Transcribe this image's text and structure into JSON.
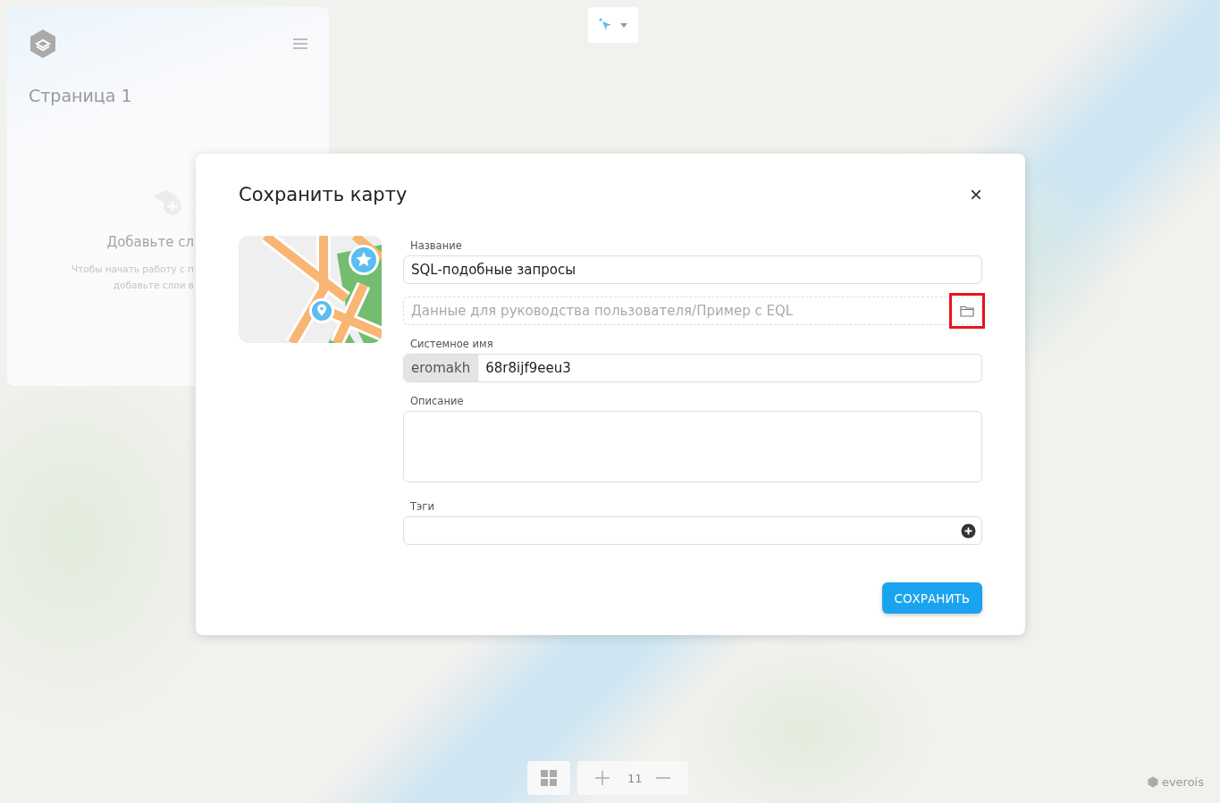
{
  "sidebar": {
    "page_title": "Страница 1",
    "empty_title": "Добавьте сл",
    "empty_hint_lines": [
      "Чтобы начать работу с п",
      "добавьте слои в"
    ]
  },
  "dialog": {
    "title": "Сохранить карту",
    "close": "×",
    "fields": [
      {
        "kind": "text",
        "label": "Название",
        "value": "SQL-подобные запросы"
      },
      {
        "kind": "folder",
        "placeholder": "Данные для руководства пользователя/Пример с EQL",
        "highlighted": true
      },
      {
        "kind": "prefixed",
        "label": "Системное имя",
        "prefix": "eromakh",
        "value": "68r8ijf9eeu3"
      },
      {
        "kind": "textarea",
        "label": "Описание"
      },
      {
        "kind": "tags",
        "label": "Тэги"
      }
    ],
    "save_button": "СОХРАНИТЬ"
  },
  "map_controls": {
    "zoom_level": "11"
  },
  "brand": "everois"
}
